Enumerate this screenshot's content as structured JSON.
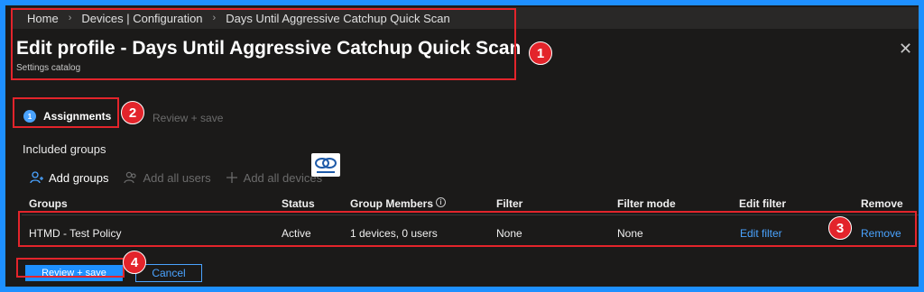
{
  "breadcrumb": {
    "items": [
      "Home",
      "Devices | Configuration",
      "Days Until Aggressive Catchup Quick Scan"
    ]
  },
  "header": {
    "title": "Edit profile - Days Until Aggressive Catchup Quick Scan",
    "subtitle": "Settings catalog",
    "close_icon": "close-icon"
  },
  "steps": [
    {
      "number": "1",
      "label": "Assignments",
      "active": true
    },
    {
      "label": "Review + save",
      "active": false
    }
  ],
  "assignments": {
    "included_label": "Included groups",
    "toolbar": [
      {
        "label": "Add groups",
        "icon": "person-add-icon",
        "enabled": true
      },
      {
        "label": "Add all users",
        "icon": "people-icon",
        "enabled": false
      },
      {
        "label": "Add all devices",
        "icon": "plus-icon",
        "enabled": false
      }
    ],
    "table": {
      "columns": [
        "Groups",
        "Status",
        "Group Members",
        "Filter",
        "Filter mode",
        "Edit filter",
        "Remove"
      ],
      "rows": [
        {
          "group": "HTMD - Test Policy",
          "status": "Active",
          "members": "1 devices, 0 users",
          "filter": "None",
          "filter_mode": "None",
          "edit_filter": "Edit filter",
          "remove": "Remove"
        }
      ]
    }
  },
  "footer": {
    "primary_label": "Review + save",
    "secondary_label": "Cancel"
  },
  "annotations": [
    "1",
    "2",
    "3",
    "4"
  ],
  "colors": {
    "accent": "#1e90ff",
    "link": "#4aa3ff",
    "annotation": "#e3242b",
    "background": "#1b1a19"
  }
}
